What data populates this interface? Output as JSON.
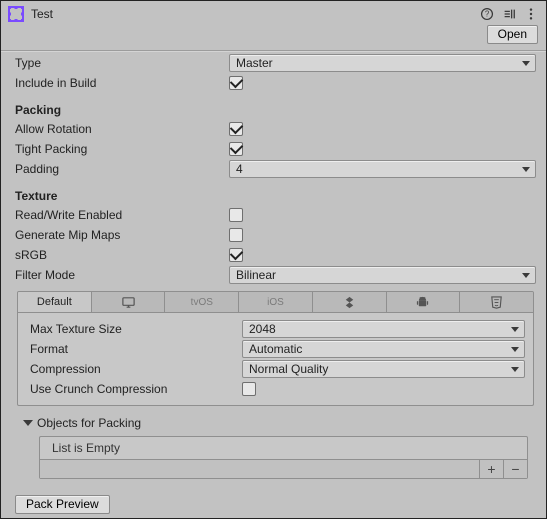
{
  "header": {
    "asset_name": "Test",
    "open_btn": "Open"
  },
  "fields": {
    "type_label": "Type",
    "type_value": "Master",
    "include_label": "Include in Build",
    "include_value": true,
    "packing_header": "Packing",
    "allow_rotation_label": "Allow Rotation",
    "allow_rotation_value": true,
    "tight_packing_label": "Tight Packing",
    "tight_packing_value": true,
    "padding_label": "Padding",
    "padding_value": "4",
    "texture_header": "Texture",
    "rw_label": "Read/Write Enabled",
    "rw_value": false,
    "mip_label": "Generate Mip Maps",
    "mip_value": false,
    "srgb_label": "sRGB",
    "srgb_value": true,
    "filter_label": "Filter Mode",
    "filter_value": "Bilinear"
  },
  "platform": {
    "tabs": {
      "default": "Default",
      "tvos": "tvOS",
      "ios": "iOS"
    },
    "max_tex_label": "Max Texture Size",
    "max_tex_value": "2048",
    "format_label": "Format",
    "format_value": "Automatic",
    "compression_label": "Compression",
    "compression_value": "Normal Quality",
    "crunch_label": "Use Crunch Compression",
    "crunch_value": false
  },
  "packing_list": {
    "header": "Objects for Packing",
    "empty": "List is Empty"
  },
  "footer": {
    "pack_preview": "Pack Preview"
  }
}
